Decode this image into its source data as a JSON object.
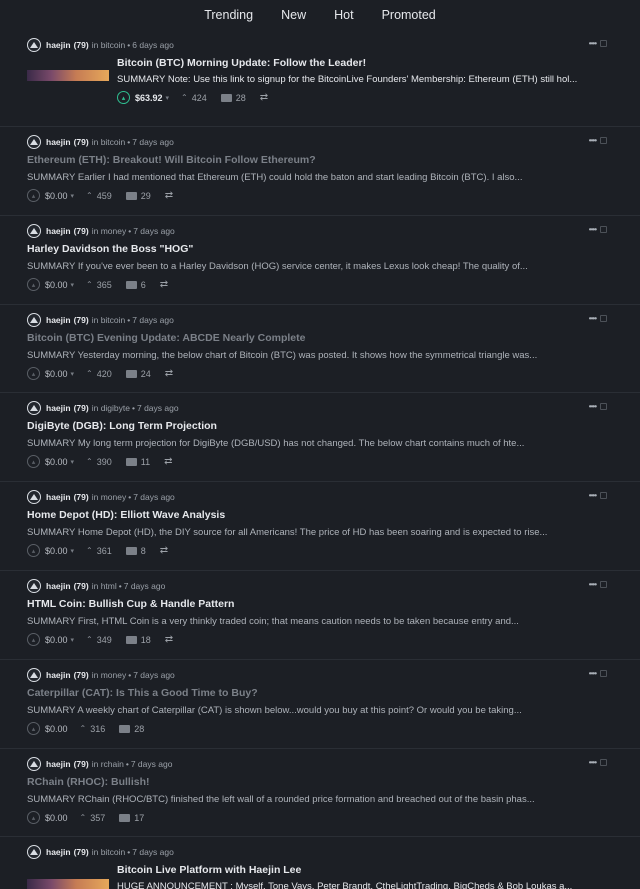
{
  "nav": {
    "tabs": [
      "Trending",
      "New",
      "Hot",
      "Promoted"
    ]
  },
  "posts": [
    {
      "author": "haejin",
      "rep": "(79)",
      "community": "bitcoin",
      "time": "6 days ago",
      "title": "Bitcoin (BTC) Morning Update: Follow the Leader!",
      "summary": "SUMMARY Note: Use this link to signup for the BitcoinLive Founders' Membership: Ethereum (ETH) still hol...",
      "payout": "$63.92",
      "votes": "424",
      "replies": "28"
    },
    {
      "author": "haejin",
      "rep": "(79)",
      "community": "bitcoin",
      "time": "7 days ago",
      "title": "Ethereum (ETH): Breakout! Will Bitcoin Follow Ethereum?",
      "summary": "SUMMARY Earlier I had mentioned that Ethereum (ETH) could hold the baton and start leading Bitcoin (BTC). I also...",
      "payout": "$0.00",
      "votes": "459",
      "replies": "29"
    },
    {
      "author": "haejin",
      "rep": "(79)",
      "community": "money",
      "time": "7 days ago",
      "title": "Harley Davidson the Boss \"HOG\"",
      "summary": "SUMMARY If you've ever been to a Harley Davidson (HOG) service center, it makes Lexus look cheap! The quality of...",
      "payout": "$0.00",
      "votes": "365",
      "replies": "6"
    },
    {
      "author": "haejin",
      "rep": "(79)",
      "community": "bitcoin",
      "time": "7 days ago",
      "title": "Bitcoin (BTC) Evening Update: ABCDE Nearly Complete",
      "summary": "SUMMARY Yesterday morning, the below chart of Bitcoin (BTC) was posted. It shows how the symmetrical triangle was...",
      "payout": "$0.00",
      "votes": "420",
      "replies": "24"
    },
    {
      "author": "haejin",
      "rep": "(79)",
      "community": "digibyte",
      "time": "7 days ago",
      "title": "DigiByte (DGB): Long Term Projection",
      "summary": "SUMMARY My long term projection for DigiByte (DGB/USD) has not changed. The below chart contains much of hte...",
      "payout": "$0.00",
      "votes": "390",
      "replies": "11"
    },
    {
      "author": "haejin",
      "rep": "(79)",
      "community": "money",
      "time": "7 days ago",
      "title": "Home Depot (HD): Elliott Wave Analysis",
      "summary": "SUMMARY Home Depot (HD), the DIY source for all Americans! The price of HD has been soaring and is expected to rise...",
      "payout": "$0.00",
      "votes": "361",
      "replies": "8"
    },
    {
      "author": "haejin",
      "rep": "(79)",
      "community": "html",
      "time": "7 days ago",
      "title": "HTML Coin: Bullish Cup & Handle Pattern",
      "summary": "SUMMARY First, HTML Coin is a very thinkly traded coin; that means caution needs to be taken because entry and...",
      "payout": "$0.00",
      "votes": "349",
      "replies": "18"
    },
    {
      "author": "haejin",
      "rep": "(79)",
      "community": "money",
      "time": "7 days ago",
      "title": "Caterpillar (CAT): Is This a Good Time to Buy?",
      "summary": "SUMMARY A weekly chart of Caterpillar (CAT) is shown below...would you buy at this point? Or would you be taking...",
      "payout": "$0.00",
      "votes": "316",
      "replies": "28"
    },
    {
      "author": "haejin",
      "rep": "(79)",
      "community": "rchain",
      "time": "7 days ago",
      "title": "RChain (RHOC): Bullish!",
      "summary": "SUMMARY RChain (RHOC/BTC) finished the left wall of a rounded price formation and breached out of the basin phas...",
      "payout": "$0.00",
      "votes": "357",
      "replies": "17"
    },
    {
      "author": "haejin",
      "rep": "(79)",
      "community": "bitcoin",
      "time": "7 days ago",
      "title": "Bitcoin Live Platform with Haejin Lee",
      "summary": "HUGE ANNOUNCEMENT : Myself, Tone Vays, Peter Brandt, CtheLightTrading, BigCheds & Bob Loukas a..."
    }
  ],
  "labels": {
    "in": "in",
    "dot": "•"
  }
}
